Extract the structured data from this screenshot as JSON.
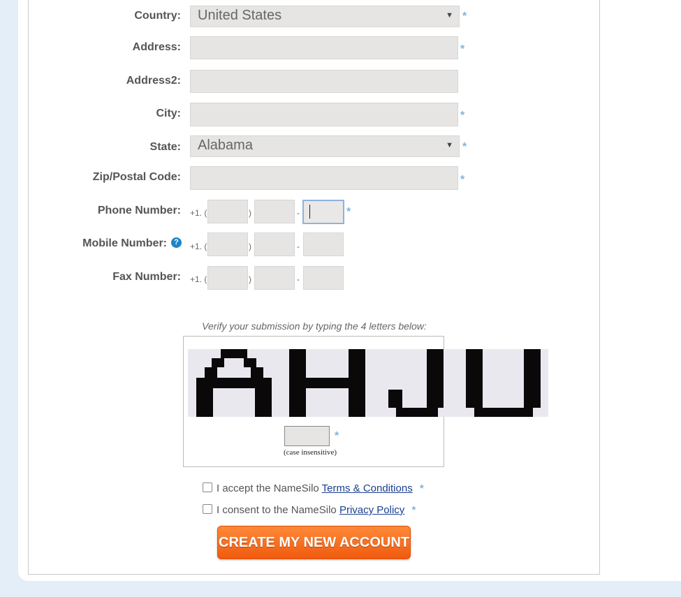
{
  "form": {
    "country_label": "Country:",
    "country_value": "United States",
    "address_label": "Address:",
    "address2_label": "Address2:",
    "city_label": "City:",
    "state_label": "State:",
    "state_value": "Alabama",
    "zip_label": "Zip/Postal Code:",
    "phone_label": "Phone Number:",
    "mobile_label": "Mobile Number:",
    "fax_label": "Fax Number:",
    "phone_prefix": "+1. (",
    "paren_close": ")",
    "dash": "-",
    "required_mark": "*",
    "help_icon_glyph": "?"
  },
  "captcha": {
    "instruction": "Verify your submission by typing the 4 letters below:",
    "letters": "AHJU",
    "note": "(case insensitive)"
  },
  "consent": {
    "terms_text": "I accept the NameSilo ",
    "terms_link": "Terms & Conditions",
    "privacy_text": "I consent to the NameSilo ",
    "privacy_link": "Privacy Policy"
  },
  "submit": {
    "label": "CREATE MY NEW ACCOUNT"
  },
  "colors": {
    "accent_orange": "#ef5a0e",
    "required_blue": "#7fb5e0",
    "link_blue": "#1a3f8f",
    "help_blue": "#1a87c9"
  }
}
